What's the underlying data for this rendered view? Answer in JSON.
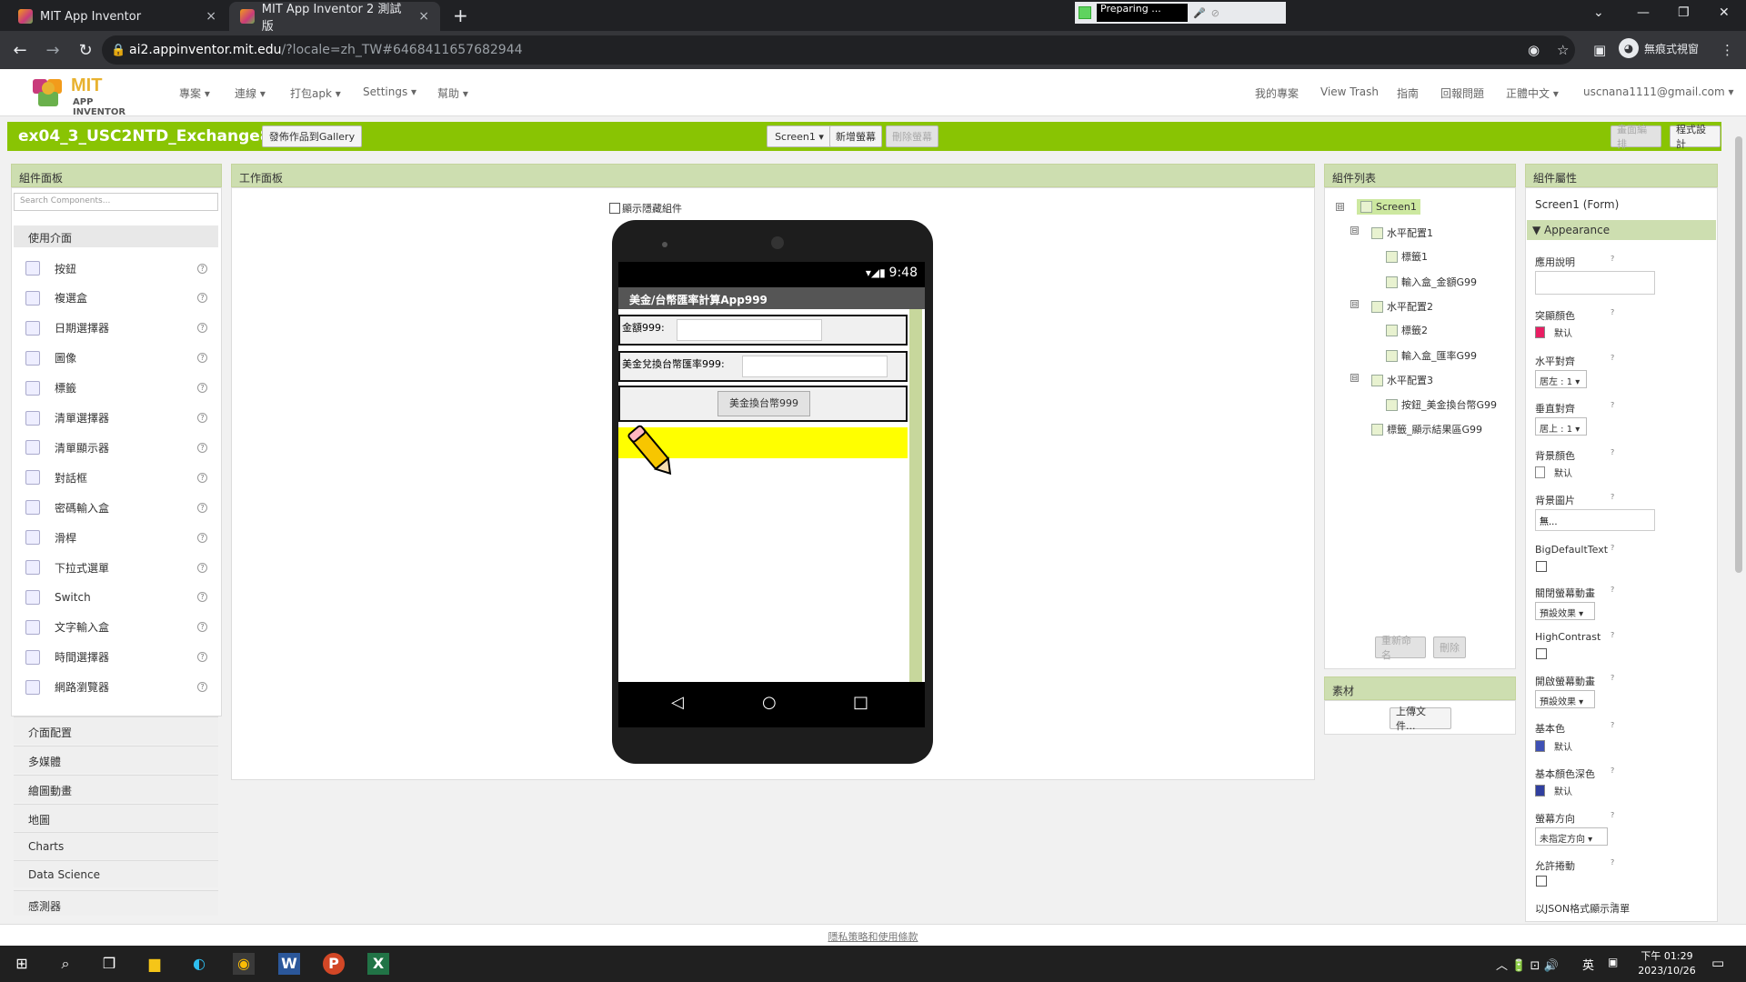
{
  "browser": {
    "tabs": [
      {
        "title": "MIT App Inventor",
        "close": "×"
      },
      {
        "title": "MIT App Inventor 2 測試版",
        "close": "×"
      }
    ],
    "new_tab": "+",
    "preparing": "Preparing ...",
    "url_domain": "ai2.appinventor.mit.edu",
    "url_path": "/?locale=zh_TW#6468411657682944",
    "incognito": "無痕式視窗"
  },
  "app": {
    "logo_title": "MIT",
    "logo_subtitle": "APP INVENTOR",
    "menu": [
      "專案 ▾",
      "連線 ▾",
      "打包apk ▾",
      "Settings ▾",
      "幫助 ▾"
    ],
    "right_menu": [
      "我的專案",
      "View Trash",
      "指南",
      "回報問題",
      "正體中文 ▾",
      "uscnana1111@gmail.com ▾"
    ],
    "project_name": "ex04_3_USC2NTD_Exchange888",
    "gallery_btn": "發佈作品到Gallery",
    "screen_select": "Screen1 ▾",
    "add_screen": "新增螢幕",
    "remove_screen": "刪除螢幕",
    "designer_btn": "畫面編排",
    "blocks_btn": "程式設計"
  },
  "palette": {
    "header": "組件面板",
    "search_placeholder": "Search Components...",
    "category_open": "使用介面",
    "items": [
      {
        "label": "按鈕",
        "icon": "button-icon"
      },
      {
        "label": "複選盒",
        "icon": "checkbox-icon"
      },
      {
        "label": "日期選擇器",
        "icon": "date-picker-icon"
      },
      {
        "label": "圖像",
        "icon": "image-icon"
      },
      {
        "label": "標籤",
        "icon": "label-icon"
      },
      {
        "label": "清單選擇器",
        "icon": "list-picker-icon"
      },
      {
        "label": "清單顯示器",
        "icon": "list-view-icon"
      },
      {
        "label": "對話框",
        "icon": "notifier-icon"
      },
      {
        "label": "密碼輸入盒",
        "icon": "password-icon"
      },
      {
        "label": "滑桿",
        "icon": "slider-icon"
      },
      {
        "label": "下拉式選單",
        "icon": "spinner-icon"
      },
      {
        "label": "Switch",
        "icon": "switch-icon"
      },
      {
        "label": "文字輸入盒",
        "icon": "textbox-icon"
      },
      {
        "label": "時間選擇器",
        "icon": "time-picker-icon"
      },
      {
        "label": "網路瀏覽器",
        "icon": "web-viewer-icon"
      }
    ],
    "help": "?",
    "categories": [
      "介面配置",
      "多媒體",
      "繪圖動畫",
      "地圖",
      "Charts",
      "Data Science",
      "感測器"
    ]
  },
  "viewer": {
    "header": "工作面板",
    "show_hidden": "顯示隱藏組件",
    "time": "9:48",
    "app_title": "美金/台幣匯率計算App999",
    "label1": "金額999:",
    "label2": "美金兌換台幣匯率999:",
    "convert_btn": "美金換台幣999",
    "nav": [
      "◁",
      "○",
      "□"
    ]
  },
  "tree": {
    "header": "組件列表",
    "nodes": [
      {
        "label": "Screen1",
        "toggle": "⊟"
      },
      {
        "label": "水平配置1",
        "toggle": "⊟"
      },
      {
        "label": "標籤1"
      },
      {
        "label": "輸入盒_金額G99"
      },
      {
        "label": "水平配置2",
        "toggle": "⊟"
      },
      {
        "label": "標籤2"
      },
      {
        "label": "輸入盒_匯率G99"
      },
      {
        "label": "水平配置3",
        "toggle": "⊟"
      },
      {
        "label": "按鈕_美金換台幣G99"
      },
      {
        "label": "標籤_顯示結果區G99"
      }
    ],
    "rename_btn": "重新命名",
    "delete_btn": "刪除"
  },
  "media": {
    "header": "素材",
    "upload_btn": "上傳文件..."
  },
  "properties": {
    "header": "組件屬性",
    "component": "Screen1 (Form)",
    "section": "▼ Appearance",
    "help": "?",
    "about": "應用說明",
    "accent_color": "突顯顏色",
    "accent_value": "默认",
    "align_h": "水平對齊",
    "align_h_value": "居左 : 1 ▾",
    "align_v": "垂直對齊",
    "align_v_value": "居上 : 1 ▾",
    "bg_color": "背景顏色",
    "bg_color_value": "默认",
    "bg_image": "背景圖片",
    "bg_image_value": "無...",
    "big_default_text": "BigDefaultText",
    "close_anim": "關閉螢幕動畫",
    "close_anim_value": "預設效果 ▾",
    "high_contrast": "HighContrast",
    "open_anim": "開啟螢幕動畫",
    "open_anim_value": "預設效果 ▾",
    "primary_color": "基本色",
    "primary_color_value": "默认",
    "primary_dark": "基本顏色深色",
    "primary_dark_value": "默认",
    "orientation": "螢幕方向",
    "orientation_value": "未指定方向 ▾",
    "scrollable": "允許捲動",
    "json_list": "以JSON格式顯示清單"
  },
  "footer": "隱私策略和使用條款",
  "taskbar": {
    "time": "下午 01:29",
    "date": "2023/10/26",
    "ime": "英"
  },
  "colors": {
    "brand_green": "#89c403",
    "accent_pink": "#e91e63",
    "primary_indigo": "#3f51b5",
    "result_yellow": "#ffff00"
  }
}
